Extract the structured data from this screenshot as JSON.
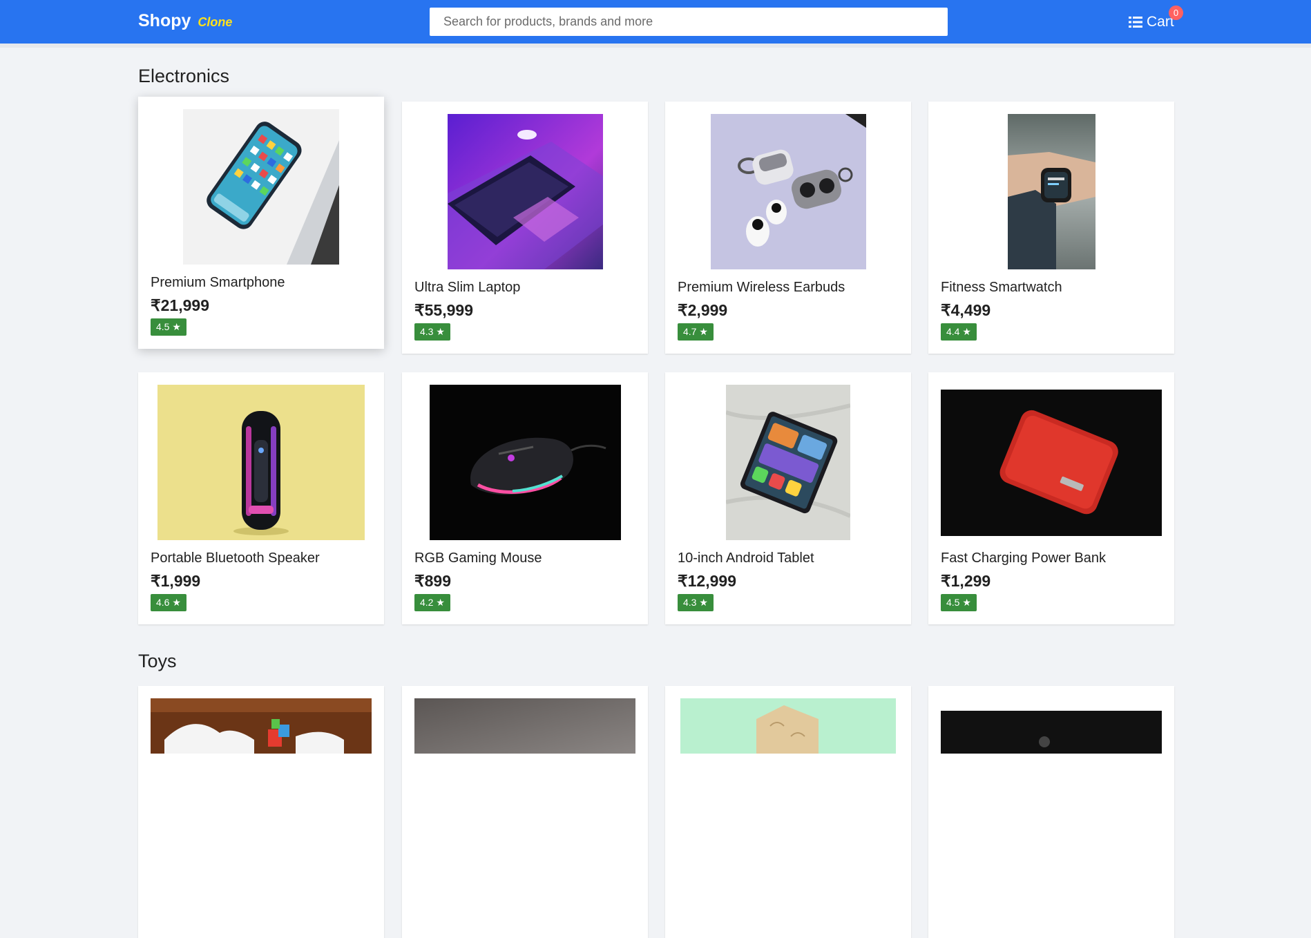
{
  "header": {
    "brand": "Shopy",
    "brand_tag": "Clone",
    "search_placeholder": "Search for products, brands and more",
    "cart_label": "Cart",
    "cart_count": "0"
  },
  "colors": {
    "header_bg": "#2874f0",
    "brand_tag": "#ffe11b",
    "rating_bg": "#388e3c",
    "badge_bg": "#ff6161",
    "page_bg": "#f1f3f6"
  },
  "sections": [
    {
      "title": "Electronics",
      "products": [
        {
          "name": "Premium Smartphone",
          "price": "₹21,999",
          "rating": "4.5 ★",
          "image": "smartphone-photo"
        },
        {
          "name": "Ultra Slim Laptop",
          "price": "₹55,999",
          "rating": "4.3 ★",
          "image": "laptop-photo"
        },
        {
          "name": "Premium Wireless Earbuds",
          "price": "₹2,999",
          "rating": "4.7 ★",
          "image": "earbuds-photo"
        },
        {
          "name": "Fitness Smartwatch",
          "price": "₹4,499",
          "rating": "4.4 ★",
          "image": "smartwatch-photo"
        },
        {
          "name": "Portable Bluetooth Speaker",
          "price": "₹1,999",
          "rating": "4.6 ★",
          "image": "speaker-photo"
        },
        {
          "name": "RGB Gaming Mouse",
          "price": "₹899",
          "rating": "4.2 ★",
          "image": "mouse-photo"
        },
        {
          "name": "10-inch Android Tablet",
          "price": "₹12,999",
          "rating": "4.3 ★",
          "image": "tablet-photo"
        },
        {
          "name": "Fast Charging Power Bank",
          "price": "₹1,299",
          "rating": "4.5 ★",
          "image": "powerbank-photo"
        }
      ]
    },
    {
      "title": "Toys",
      "products": [
        {
          "image": "toy-puzzle-photo"
        },
        {
          "image": "toy-gray-photo"
        },
        {
          "image": "toy-jigsaw-photo"
        },
        {
          "image": "toy-dark-photo"
        }
      ]
    }
  ]
}
